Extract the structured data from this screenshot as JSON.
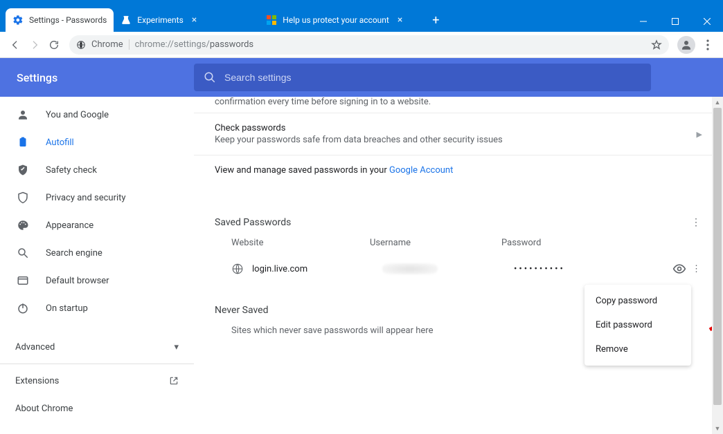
{
  "window": {
    "tabs": [
      {
        "label": "Settings - Passwords",
        "active": true
      },
      {
        "label": "Experiments",
        "active": false
      },
      {
        "label": "Help us protect your account",
        "active": false
      }
    ]
  },
  "toolbar": {
    "chrome_chip_icon_label": "Chrome",
    "address_prefix": "chrome://settings/",
    "address_page": "passwords"
  },
  "settings": {
    "title": "Settings",
    "search_placeholder": "Search settings",
    "sidebar": [
      {
        "label": "You and Google"
      },
      {
        "label": "Autofill"
      },
      {
        "label": "Safety check"
      },
      {
        "label": "Privacy and security"
      },
      {
        "label": "Appearance"
      },
      {
        "label": "Search engine"
      },
      {
        "label": "Default browser"
      },
      {
        "label": "On startup"
      }
    ],
    "advanced": "Advanced",
    "extensions": "Extensions",
    "about": "About Chrome"
  },
  "content": {
    "snippet": "confirmation every time before signing in to a website.",
    "check_title": "Check passwords",
    "check_sub": "Keep your passwords safe from data breaches and other security issues",
    "view_manage_pre": "View and manage saved passwords in your ",
    "view_manage_link": "Google Account",
    "saved_section": "Saved Passwords",
    "col_website": "Website",
    "col_username": "Username",
    "col_password": "Password",
    "row1_site": "login.live.com",
    "row1_pass_mask": "••••••••••",
    "never_title": "Never Saved",
    "never_sub": "Sites which never save passwords will appear here"
  },
  "menu": {
    "copy": "Copy password",
    "edit": "Edit password",
    "remove": "Remove"
  }
}
